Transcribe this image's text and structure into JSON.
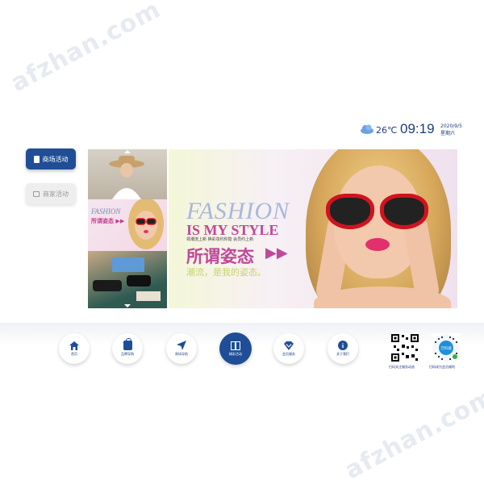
{
  "watermark": {
    "text": "afzhan.com"
  },
  "status": {
    "temperature": "26℃",
    "time": "09:19",
    "date": "2020/9/5",
    "weekday": "星期六",
    "weather_icon": "cloud-icon"
  },
  "side_menu": [
    {
      "label": "商场活动",
      "icon": "document-icon",
      "active": true
    },
    {
      "label": "商家活动",
      "icon": "calendar-icon",
      "active": false
    }
  ],
  "thumbnails": {
    "middle_title": "FASHION",
    "middle_sub": "所谓姿态 ▶▶"
  },
  "banner": {
    "headline_en": "FASHION",
    "tagline_en": "IS MY STYLE",
    "small_text": "领潮流上新 换彩妆约你隐 会员约上新",
    "headline_cn": "所谓姿态",
    "arrows": "▶▶",
    "subline_cn": "潮流，是我的姿态。"
  },
  "bottom_nav": [
    {
      "label": "首页",
      "icon": "home-icon",
      "active": false
    },
    {
      "label": "品牌导购",
      "icon": "shopping-bag-icon",
      "active": false
    },
    {
      "label": "商场导航",
      "icon": "paper-plane-icon",
      "active": false
    },
    {
      "label": "精彩活动",
      "icon": "gift-icon",
      "active": true
    },
    {
      "label": "会员服务",
      "icon": "diamond-icon",
      "active": false
    },
    {
      "label": "关于我们",
      "icon": "info-icon",
      "active": false
    }
  ],
  "qr_codes": [
    {
      "caption": "扫码关注服务动态"
    },
    {
      "caption": "扫码成为会员福利"
    }
  ],
  "qr2_center": "万科城",
  "colors": {
    "accent": "#1f4e96",
    "banner_pink": "#c0489a"
  }
}
